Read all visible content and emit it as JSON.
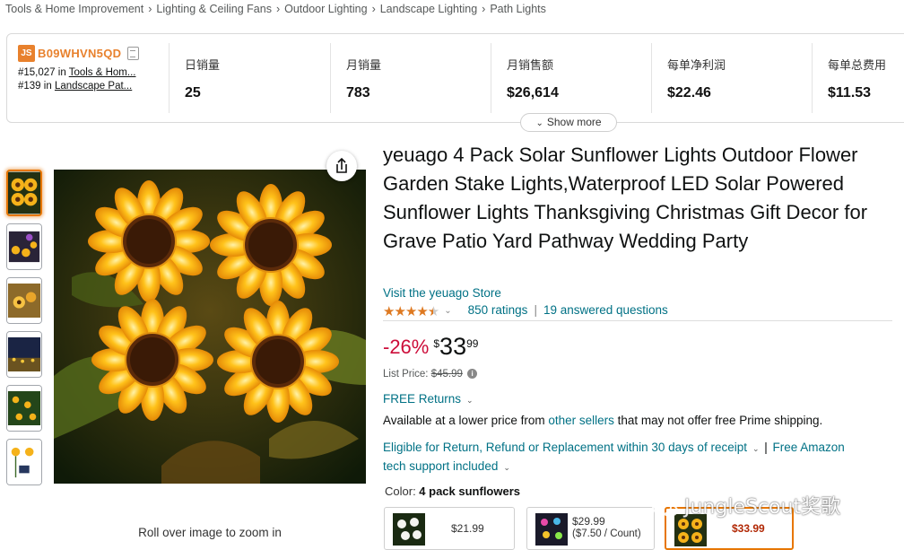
{
  "breadcrumb": [
    "Tools & Home Improvement",
    "Lighting & Ceiling Fans",
    "Outdoor Lighting",
    "Landscape Lighting",
    "Path Lights"
  ],
  "breadcrumb_separator": "›",
  "jungle_scout": {
    "logo_text": "JS",
    "asin": "B09WHVN5QD",
    "rank1_prefix": "#15,027 in ",
    "rank1_link": "Tools & Hom...",
    "rank2_prefix": "#139 in ",
    "rank2_link": "Landscape Pat...",
    "stats": [
      {
        "label": "日销量",
        "value": "25"
      },
      {
        "label": "月销量",
        "value": "783"
      },
      {
        "label": "月销售额",
        "value": "$26,614"
      },
      {
        "label": "每单净利润",
        "value": "$22.46"
      },
      {
        "label": "每单总费用",
        "value": "$11.53"
      }
    ],
    "show_more": "Show more"
  },
  "product": {
    "title": "yeuago 4 Pack Solar Sunflower Lights Outdoor Flower Garden Stake Lights,Waterproof LED Solar Powered Sunflower Lights Thanksgiving Christmas Gift Decor for Grave Patio Yard Pathway Wedding Party",
    "store_link": "Visit the yeuago Store",
    "rating_stars": 4.5,
    "ratings_count": "850 ratings",
    "answered": "19 answered questions",
    "discount": "-26%",
    "price_symbol": "$",
    "price_whole": "33",
    "price_fraction": "99",
    "list_price_label": "List Price: ",
    "list_price": "$45.99",
    "free_returns": "FREE Returns",
    "lower_price_text": "Available at a lower price from ",
    "other_sellers": "other sellers",
    "lower_price_suffix": " that may not offer free Prime shipping.",
    "eligible_text": "Eligible for Return, Refund or Replacement within 30 days of receipt",
    "free_amazon": "Free Amazon",
    "tech_support": "tech support included",
    "color_label": "Color: ",
    "color_value": "4 pack sunflowers",
    "swatches": [
      {
        "price": "$21.99",
        "sub": ""
      },
      {
        "price": "$29.99",
        "sub": "($7.50 / Count)"
      },
      {
        "price": "$33.99",
        "sub": ""
      }
    ]
  },
  "zoom_hint": "Roll over image to zoom in",
  "watermark": "JungleScout奖歌",
  "colors": {
    "accent_orange": "#e77600",
    "link": "#007185",
    "deal_red": "#cc0c39",
    "star": "#de7921",
    "js_orange": "#e8812d"
  },
  "icons": [
    "copy-icon",
    "share-icon",
    "chevron-down-icon",
    "info-icon",
    "star-icon"
  ]
}
